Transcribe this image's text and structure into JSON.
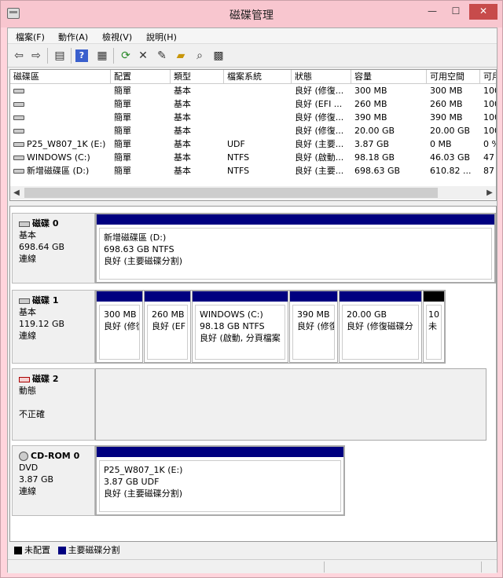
{
  "window": {
    "title": "磁碟管理"
  },
  "menu": [
    "檔案(F)",
    "動作(A)",
    "檢視(V)",
    "說明(H)"
  ],
  "toolbar": {
    "icons": [
      "back-icon",
      "forward-icon",
      "console-icon",
      "help-icon",
      "properties-icon",
      "refresh-icon",
      "delete-icon",
      "edit-properties-icon",
      "open-icon",
      "search-icon",
      "settings-icon"
    ]
  },
  "volume_list": {
    "headers": [
      "磁碟區",
      "配置",
      "類型",
      "檔案系統",
      "狀態",
      "容量",
      "可用空間",
      "可用"
    ],
    "rows": [
      {
        "name": "",
        "layout": "簡單",
        "type": "基本",
        "fs": "",
        "status": "良好 (修復...",
        "capacity": "300 MB",
        "free": "300 MB",
        "pct": "100"
      },
      {
        "name": "",
        "layout": "簡單",
        "type": "基本",
        "fs": "",
        "status": "良好 (EFI ...",
        "capacity": "260 MB",
        "free": "260 MB",
        "pct": "100"
      },
      {
        "name": "",
        "layout": "簡單",
        "type": "基本",
        "fs": "",
        "status": "良好 (修復...",
        "capacity": "390 MB",
        "free": "390 MB",
        "pct": "100"
      },
      {
        "name": "",
        "layout": "簡單",
        "type": "基本",
        "fs": "",
        "status": "良好 (修復...",
        "capacity": "20.00 GB",
        "free": "20.00 GB",
        "pct": "100"
      },
      {
        "name": "P25_W807_1K (E:)",
        "layout": "簡單",
        "type": "基本",
        "fs": "UDF",
        "status": "良好 (主要...",
        "capacity": "3.87 GB",
        "free": "0 MB",
        "pct": "0 %"
      },
      {
        "name": "WINDOWS (C:)",
        "layout": "簡單",
        "type": "基本",
        "fs": "NTFS",
        "status": "良好 (啟動...",
        "capacity": "98.18 GB",
        "free": "46.03 GB",
        "pct": "47"
      },
      {
        "name": "新增磁碟區 (D:)",
        "layout": "簡單",
        "type": "基本",
        "fs": "NTFS",
        "status": "良好 (主要...",
        "capacity": "698.63 GB",
        "free": "610.82 ...",
        "pct": "87"
      }
    ]
  },
  "disks": [
    {
      "name": "磁碟 0",
      "kind": "基本",
      "size": "698.64 GB",
      "state": "連線",
      "partitions": [
        {
          "title": "新增磁碟區 (D:)",
          "line1": "698.63 GB NTFS",
          "line2": "良好 (主要磁碟分割)"
        }
      ]
    },
    {
      "name": "磁碟 1",
      "kind": "基本",
      "size": "119.12 GB",
      "state": "連線",
      "partitions": [
        {
          "title": "",
          "line1": "300 MB",
          "line2": "良好 (修復"
        },
        {
          "title": "",
          "line1": "260 MB",
          "line2": "良好 (EF"
        },
        {
          "title": "WINDOWS (C:)",
          "line1": "98.18 GB NTFS",
          "line2": "良好 (啟動, 分頁檔案"
        },
        {
          "title": "",
          "line1": "390 MB",
          "line2": "良好 (修復"
        },
        {
          "title": "",
          "line1": "20.00 GB",
          "line2": "良好 (修復磁碟分"
        },
        {
          "title": "",
          "line1": "10",
          "line2": "未"
        }
      ]
    },
    {
      "name": "磁碟 2",
      "kind": "動態",
      "size": "",
      "state": "不正確",
      "partitions": []
    },
    {
      "name": "CD-ROM 0",
      "kind": "DVD",
      "size": "3.87 GB",
      "state": "連線",
      "partitions": [
        {
          "title": "P25_W807_1K (E:)",
          "line1": "3.87 GB UDF",
          "line2": "良好 (主要磁碟分割)"
        }
      ]
    }
  ],
  "legend": [
    {
      "label": "未配置",
      "color": "#000000"
    },
    {
      "label": "主要磁碟分割",
      "color": "#000080"
    }
  ]
}
